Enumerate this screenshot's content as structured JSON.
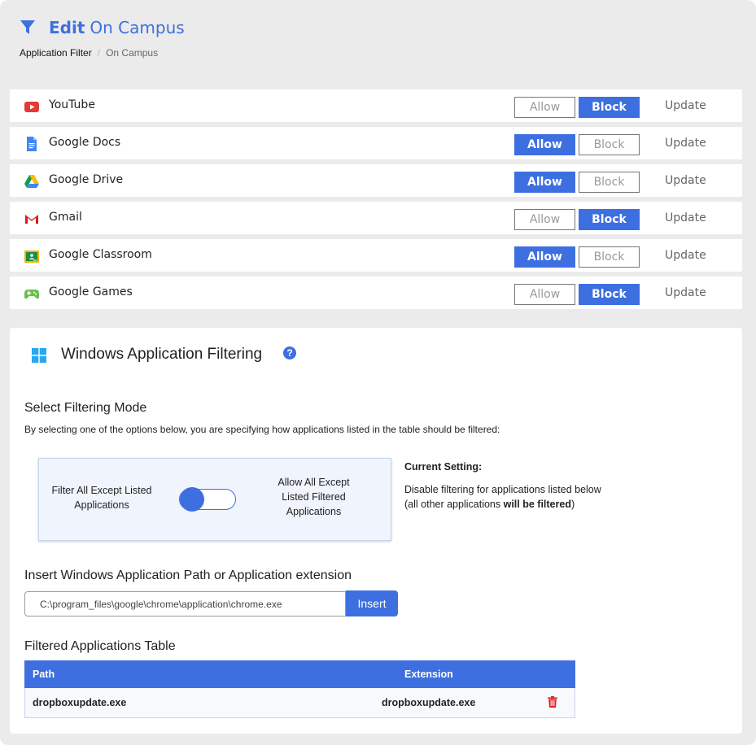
{
  "header": {
    "edit_label": "Edit",
    "title": "On Campus",
    "breadcrumb": [
      "Application Filter",
      "On Campus"
    ],
    "separator": "/"
  },
  "apps": [
    {
      "name": "YouTube",
      "icon": "youtube-icon",
      "state": "Block",
      "allow_label": "Allow",
      "block_label": "Block",
      "update_label": "Update"
    },
    {
      "name": "Google Docs",
      "icon": "google-docs-icon",
      "state": "Allow",
      "allow_label": "Allow",
      "block_label": "Block",
      "update_label": "Update"
    },
    {
      "name": "Google Drive",
      "icon": "google-drive-icon",
      "state": "Allow",
      "allow_label": "Allow",
      "block_label": "Block",
      "update_label": "Update"
    },
    {
      "name": "Gmail",
      "icon": "gmail-icon",
      "state": "Block",
      "allow_label": "Allow",
      "block_label": "Block",
      "update_label": "Update"
    },
    {
      "name": "Google Classroom",
      "icon": "google-classroom-icon",
      "state": "Allow",
      "allow_label": "Allow",
      "block_label": "Block",
      "update_label": "Update"
    },
    {
      "name": "Google Games",
      "icon": "gamepad-icon",
      "state": "Block",
      "allow_label": "Allow",
      "block_label": "Block",
      "update_label": "Update"
    }
  ],
  "windows": {
    "title": "Windows Application Filtering",
    "help": "?",
    "mode_heading": "Select Filtering Mode",
    "mode_description": "By selecting one of the options below, you are specifying how applications listed in the table should be filtered:",
    "option_left": "Filter All Except Listed Applications",
    "option_right": "Allow All Except Listed Filtered Applications",
    "toggle_position": "left",
    "current_setting_label": "Current Setting:",
    "current_setting_line1": "Disable filtering for applications listed below",
    "current_setting_line2_pre": "(all other applications ",
    "current_setting_line2_bold": "will be filtered",
    "current_setting_line2_post": ")",
    "insert_heading": "Insert Windows Application Path or Application extension",
    "path_value": "C:\\program_files\\google\\chrome\\application\\chrome.exe",
    "insert_label": "Insert",
    "table_heading": "Filtered Applications Table",
    "table_headers": {
      "path": "Path",
      "extension": "Extension"
    },
    "table_rows": [
      {
        "path": "dropboxupdate.exe",
        "extension": "dropboxupdate.exe"
      }
    ]
  },
  "colors": {
    "accent": "#3d6fe0",
    "delete": "#e02020",
    "youtube": "#e53935",
    "docs": "#4285f4",
    "classroom": "#1e8e3e",
    "games": "#6abf4b"
  }
}
